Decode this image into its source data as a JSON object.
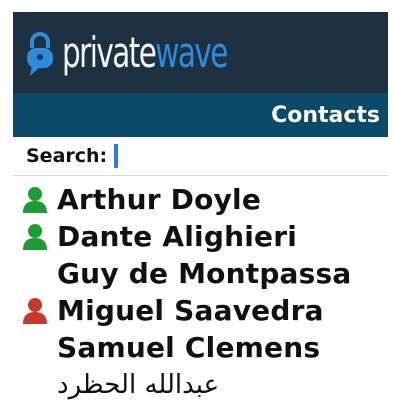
{
  "header": {
    "logo_part1": "private",
    "logo_part2": "wave",
    "logo_icon": "lock-chat-bubble-icon"
  },
  "titlebar": {
    "title": "Contacts"
  },
  "search": {
    "label": "Search:",
    "value": ""
  },
  "contacts": [
    {
      "name": "Arthur Doyle",
      "icon": "person-icon",
      "status_color": "#1f9b34"
    },
    {
      "name": "Dante Alighieri",
      "icon": "person-icon",
      "status_color": "#1f9b34"
    },
    {
      "name": "Guy de Montpassa",
      "icon": "",
      "status_color": ""
    },
    {
      "name": "Miguel Saavedra",
      "icon": "person-icon",
      "status_color": "#c9392b"
    },
    {
      "name": "Samuel Clemens",
      "icon": "",
      "status_color": ""
    },
    {
      "name": "عبدالله الحظرد",
      "icon": "",
      "status_color": ""
    }
  ],
  "colors": {
    "header_bg": "#1e3140",
    "title_bg": "#0b4a68",
    "accent": "#2a8ee0"
  }
}
